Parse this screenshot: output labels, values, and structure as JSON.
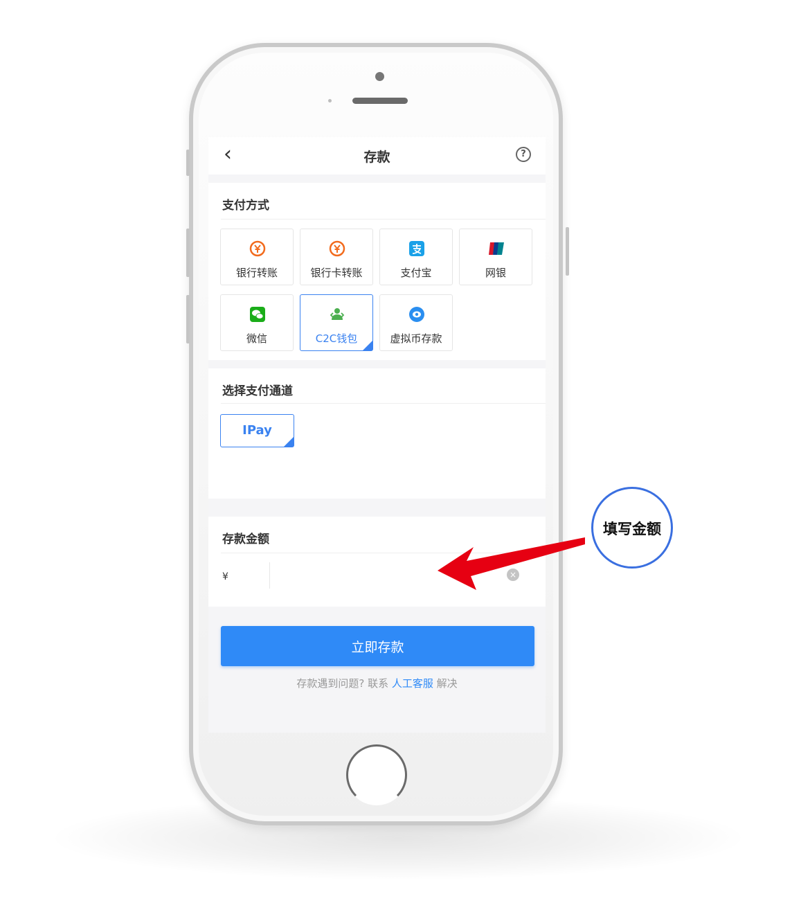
{
  "header": {
    "title": "存款",
    "back_icon": "chevron-left-icon",
    "help_icon": "question-circle-icon",
    "help_glyph": "?"
  },
  "payment_methods": {
    "title": "支付方式",
    "items": [
      {
        "label": "银行转账",
        "icon": "bank-transfer-icon",
        "color": "#f26b1d",
        "selected": false
      },
      {
        "label": "银行卡转账",
        "icon": "bank-card-icon",
        "color": "#f26b1d",
        "selected": false
      },
      {
        "label": "支付宝",
        "icon": "alipay-icon",
        "color": "#1aa1e8",
        "selected": false
      },
      {
        "label": "网银",
        "icon": "unionpay-icon",
        "color": "#d7182a",
        "selected": false
      },
      {
        "label": "微信",
        "icon": "wechat-icon",
        "color": "#1aad19",
        "selected": false
      },
      {
        "label": "C2C钱包",
        "icon": "c2c-wallet-icon",
        "color": "#4caf50",
        "selected": true
      },
      {
        "label": "虚拟币存款",
        "icon": "crypto-coin-icon",
        "color": "#2a8ef0",
        "selected": false
      }
    ]
  },
  "channel": {
    "title": "选择支付通道",
    "options": [
      {
        "label": "IPay",
        "selected": true
      }
    ]
  },
  "amount": {
    "title": "存款金额",
    "currency": "¥",
    "value": "",
    "placeholder": "",
    "clear_glyph": "×"
  },
  "submit_label": "立即存款",
  "help_text": {
    "before": "存款遇到问题? 联系 ",
    "link": "人工客服",
    "after": " 解决"
  },
  "annotation": {
    "label": "填写金额",
    "arrow_color": "#e60012",
    "circle_color": "#3a6fe0"
  },
  "accent_color": "#2f8af7"
}
